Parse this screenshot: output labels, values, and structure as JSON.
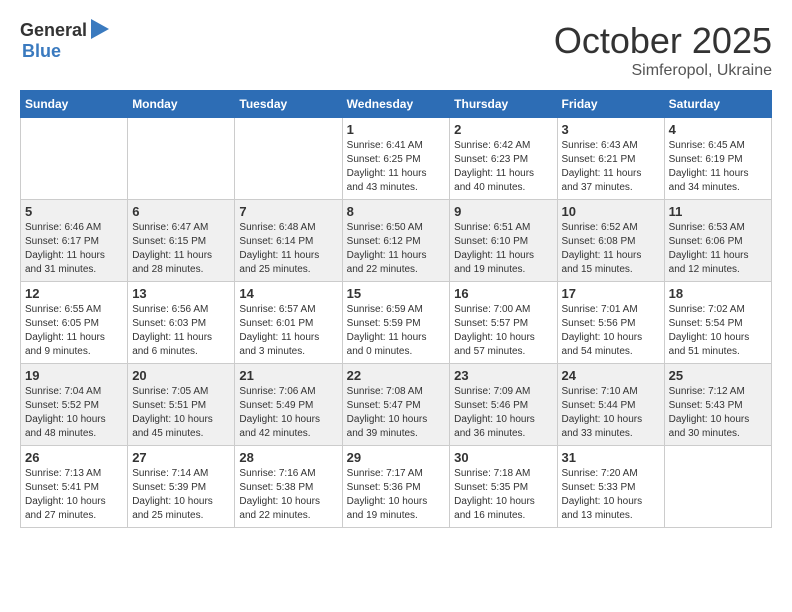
{
  "header": {
    "logo_general": "General",
    "logo_blue": "Blue",
    "month_title": "October 2025",
    "location": "Simferopol, Ukraine"
  },
  "weekdays": [
    "Sunday",
    "Monday",
    "Tuesday",
    "Wednesday",
    "Thursday",
    "Friday",
    "Saturday"
  ],
  "weeks": [
    [
      {
        "day": "",
        "info": ""
      },
      {
        "day": "",
        "info": ""
      },
      {
        "day": "",
        "info": ""
      },
      {
        "day": "1",
        "info": "Sunrise: 6:41 AM\nSunset: 6:25 PM\nDaylight: 11 hours\nand 43 minutes."
      },
      {
        "day": "2",
        "info": "Sunrise: 6:42 AM\nSunset: 6:23 PM\nDaylight: 11 hours\nand 40 minutes."
      },
      {
        "day": "3",
        "info": "Sunrise: 6:43 AM\nSunset: 6:21 PM\nDaylight: 11 hours\nand 37 minutes."
      },
      {
        "day": "4",
        "info": "Sunrise: 6:45 AM\nSunset: 6:19 PM\nDaylight: 11 hours\nand 34 minutes."
      }
    ],
    [
      {
        "day": "5",
        "info": "Sunrise: 6:46 AM\nSunset: 6:17 PM\nDaylight: 11 hours\nand 31 minutes."
      },
      {
        "day": "6",
        "info": "Sunrise: 6:47 AM\nSunset: 6:15 PM\nDaylight: 11 hours\nand 28 minutes."
      },
      {
        "day": "7",
        "info": "Sunrise: 6:48 AM\nSunset: 6:14 PM\nDaylight: 11 hours\nand 25 minutes."
      },
      {
        "day": "8",
        "info": "Sunrise: 6:50 AM\nSunset: 6:12 PM\nDaylight: 11 hours\nand 22 minutes."
      },
      {
        "day": "9",
        "info": "Sunrise: 6:51 AM\nSunset: 6:10 PM\nDaylight: 11 hours\nand 19 minutes."
      },
      {
        "day": "10",
        "info": "Sunrise: 6:52 AM\nSunset: 6:08 PM\nDaylight: 11 hours\nand 15 minutes."
      },
      {
        "day": "11",
        "info": "Sunrise: 6:53 AM\nSunset: 6:06 PM\nDaylight: 11 hours\nand 12 minutes."
      }
    ],
    [
      {
        "day": "12",
        "info": "Sunrise: 6:55 AM\nSunset: 6:05 PM\nDaylight: 11 hours\nand 9 minutes."
      },
      {
        "day": "13",
        "info": "Sunrise: 6:56 AM\nSunset: 6:03 PM\nDaylight: 11 hours\nand 6 minutes."
      },
      {
        "day": "14",
        "info": "Sunrise: 6:57 AM\nSunset: 6:01 PM\nDaylight: 11 hours\nand 3 minutes."
      },
      {
        "day": "15",
        "info": "Sunrise: 6:59 AM\nSunset: 5:59 PM\nDaylight: 11 hours\nand 0 minutes."
      },
      {
        "day": "16",
        "info": "Sunrise: 7:00 AM\nSunset: 5:57 PM\nDaylight: 10 hours\nand 57 minutes."
      },
      {
        "day": "17",
        "info": "Sunrise: 7:01 AM\nSunset: 5:56 PM\nDaylight: 10 hours\nand 54 minutes."
      },
      {
        "day": "18",
        "info": "Sunrise: 7:02 AM\nSunset: 5:54 PM\nDaylight: 10 hours\nand 51 minutes."
      }
    ],
    [
      {
        "day": "19",
        "info": "Sunrise: 7:04 AM\nSunset: 5:52 PM\nDaylight: 10 hours\nand 48 minutes."
      },
      {
        "day": "20",
        "info": "Sunrise: 7:05 AM\nSunset: 5:51 PM\nDaylight: 10 hours\nand 45 minutes."
      },
      {
        "day": "21",
        "info": "Sunrise: 7:06 AM\nSunset: 5:49 PM\nDaylight: 10 hours\nand 42 minutes."
      },
      {
        "day": "22",
        "info": "Sunrise: 7:08 AM\nSunset: 5:47 PM\nDaylight: 10 hours\nand 39 minutes."
      },
      {
        "day": "23",
        "info": "Sunrise: 7:09 AM\nSunset: 5:46 PM\nDaylight: 10 hours\nand 36 minutes."
      },
      {
        "day": "24",
        "info": "Sunrise: 7:10 AM\nSunset: 5:44 PM\nDaylight: 10 hours\nand 33 minutes."
      },
      {
        "day": "25",
        "info": "Sunrise: 7:12 AM\nSunset: 5:43 PM\nDaylight: 10 hours\nand 30 minutes."
      }
    ],
    [
      {
        "day": "26",
        "info": "Sunrise: 7:13 AM\nSunset: 5:41 PM\nDaylight: 10 hours\nand 27 minutes."
      },
      {
        "day": "27",
        "info": "Sunrise: 7:14 AM\nSunset: 5:39 PM\nDaylight: 10 hours\nand 25 minutes."
      },
      {
        "day": "28",
        "info": "Sunrise: 7:16 AM\nSunset: 5:38 PM\nDaylight: 10 hours\nand 22 minutes."
      },
      {
        "day": "29",
        "info": "Sunrise: 7:17 AM\nSunset: 5:36 PM\nDaylight: 10 hours\nand 19 minutes."
      },
      {
        "day": "30",
        "info": "Sunrise: 7:18 AM\nSunset: 5:35 PM\nDaylight: 10 hours\nand 16 minutes."
      },
      {
        "day": "31",
        "info": "Sunrise: 7:20 AM\nSunset: 5:33 PM\nDaylight: 10 hours\nand 13 minutes."
      },
      {
        "day": "",
        "info": ""
      }
    ]
  ]
}
